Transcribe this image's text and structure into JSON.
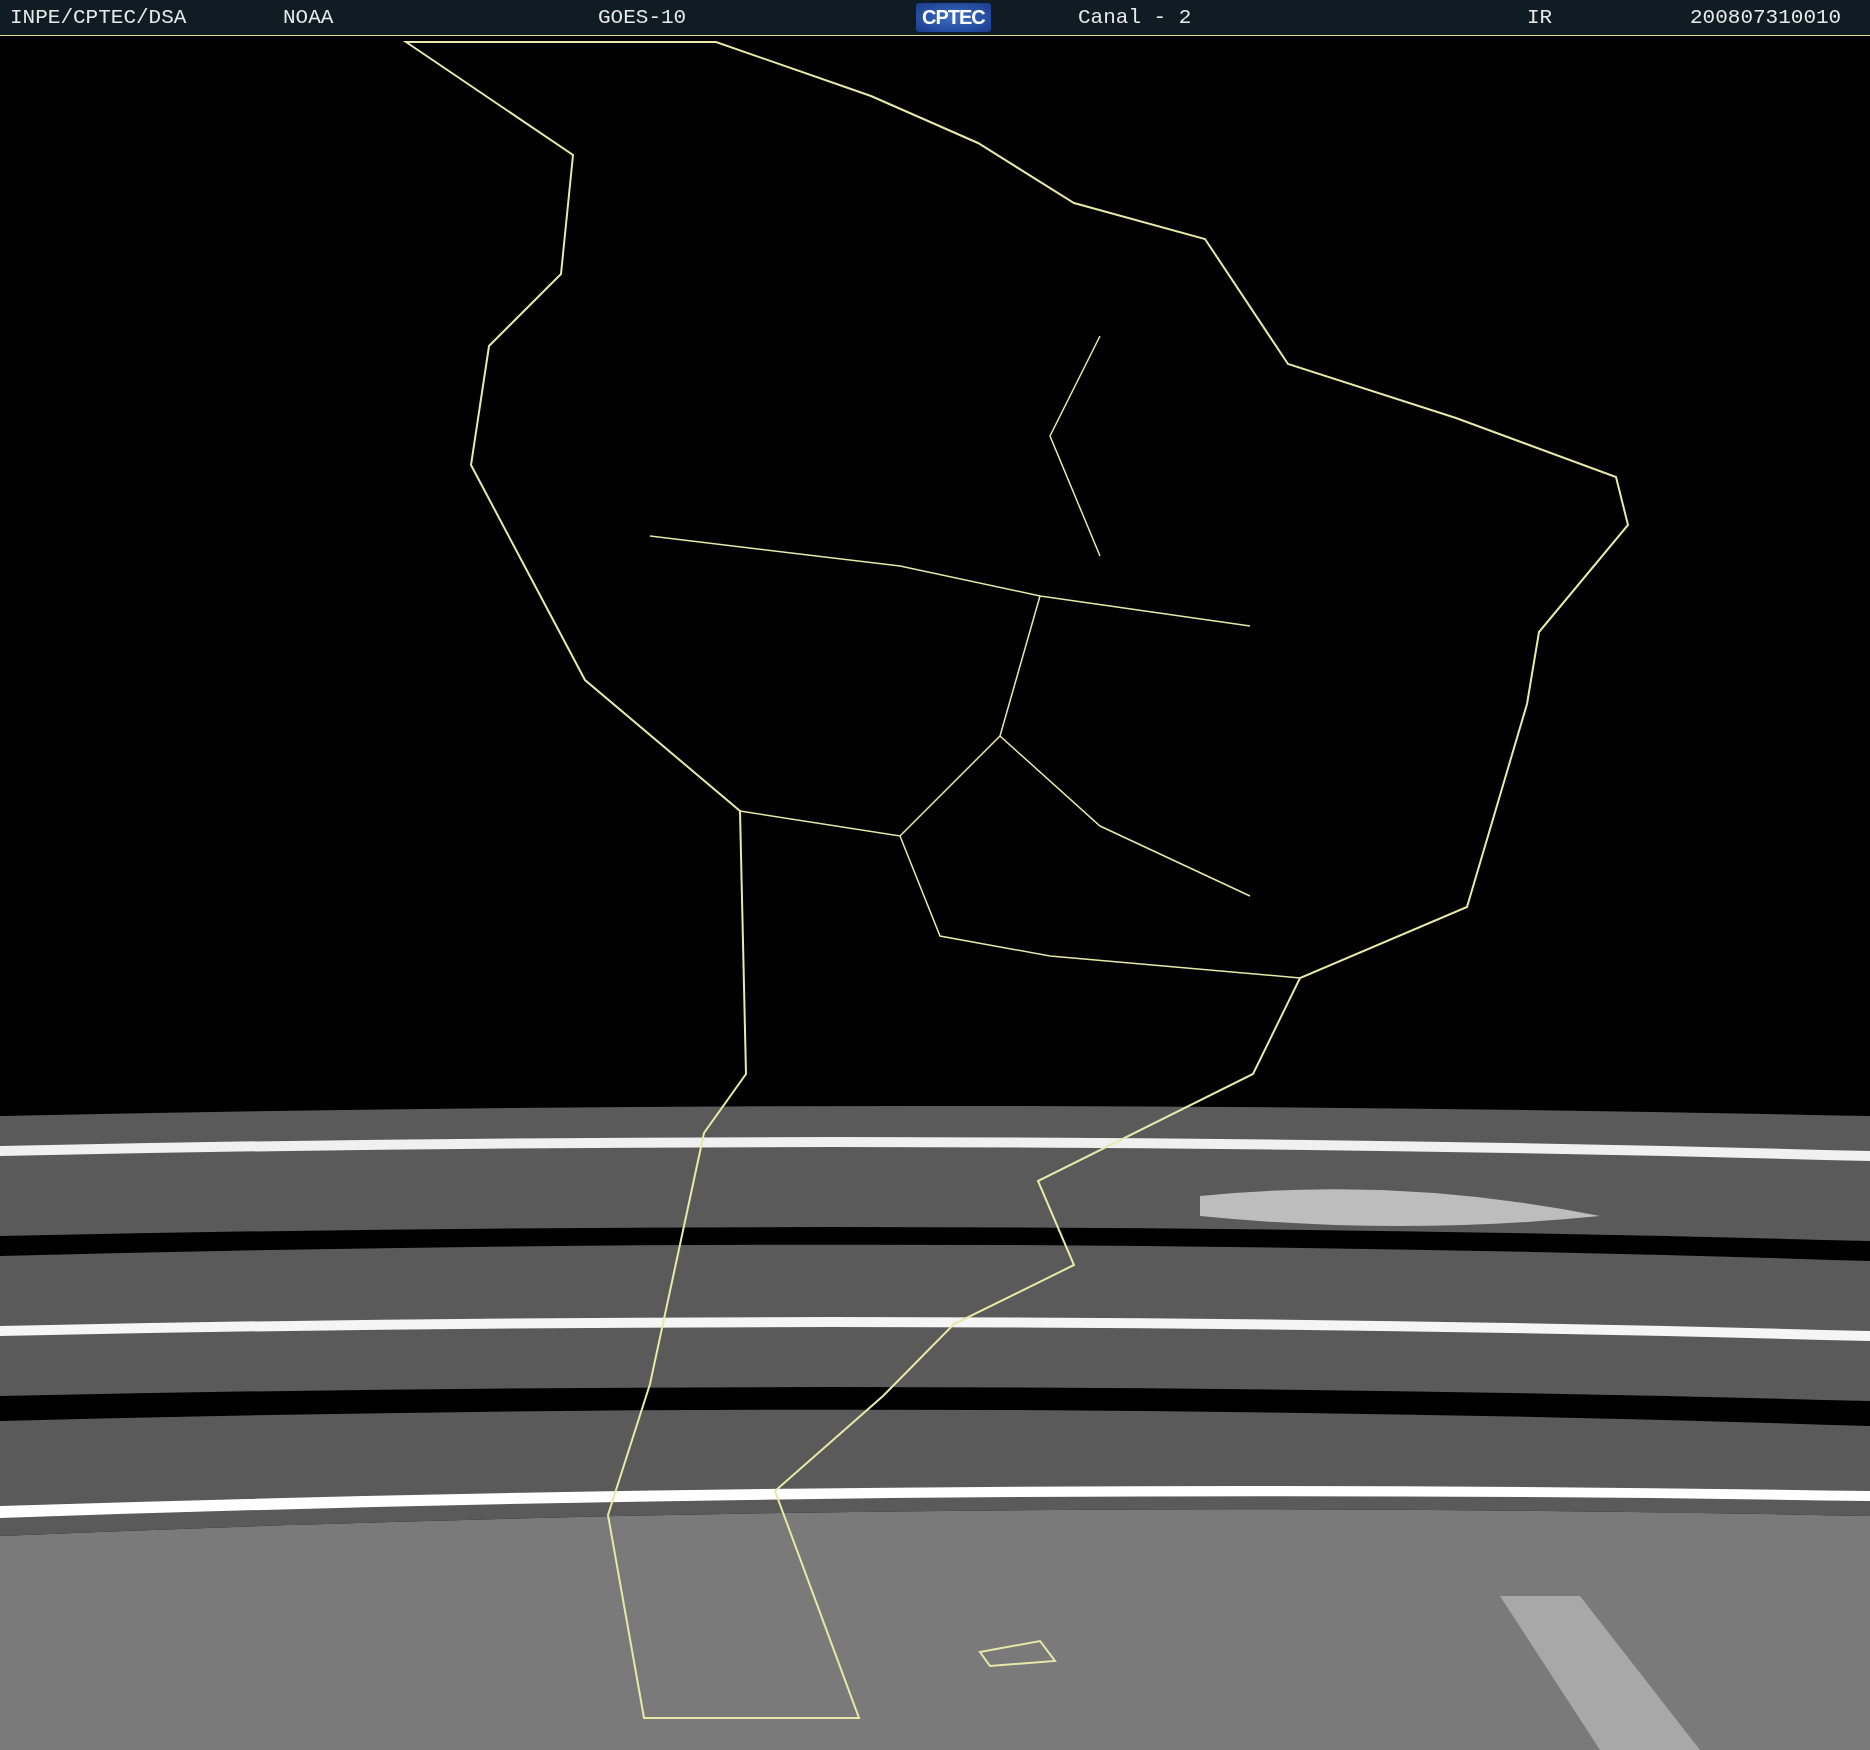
{
  "header": {
    "items": [
      {
        "kind": "text",
        "text": "INPE/CPTEC/DSA"
      },
      {
        "kind": "text",
        "text": "NOAA"
      },
      {
        "kind": "text",
        "text": "GOES-10"
      },
      {
        "kind": "logo",
        "text": "CPTEC"
      },
      {
        "kind": "text",
        "text": "Canal - 2"
      },
      {
        "kind": "text",
        "text": "IR"
      },
      {
        "kind": "text",
        "text": "200807310010"
      }
    ]
  }
}
